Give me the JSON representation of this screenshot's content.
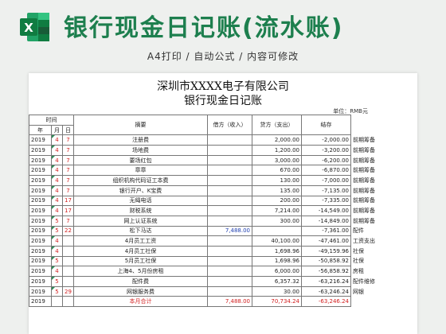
{
  "banner": {
    "title": "银行现金日记账(流水账)",
    "subtitle": "A4打印 / 自动公式 / 内容可修改",
    "logo_letter": "X"
  },
  "sheet": {
    "company": "深圳市XXXX电子有限公司",
    "title": "银行现金日记账",
    "unit": "单位：RMB元",
    "headers": {
      "time": "时间",
      "year": "年",
      "month": "月",
      "day": "日",
      "summary": "摘要",
      "debit": "借方（收入）",
      "credit": "贷方（支出）",
      "balance": "结存"
    },
    "rows": [
      {
        "year": "2019",
        "month": "4",
        "day": "7",
        "summary": "注册费",
        "debit": "",
        "credit": "2,000.00",
        "balance": "-2,000.00",
        "note": "前期筹备"
      },
      {
        "year": "2019",
        "month": "4",
        "day": "7",
        "summary": "场地费",
        "debit": "",
        "credit": "1,200.00",
        "balance": "-3,200.00",
        "note": "前期筹备"
      },
      {
        "year": "2019",
        "month": "4",
        "day": "7",
        "summary": "要场红包",
        "debit": "",
        "credit": "3,000.00",
        "balance": "-6,200.00",
        "note": "前期筹备"
      },
      {
        "year": "2019",
        "month": "4",
        "day": "7",
        "summary": "章章",
        "debit": "",
        "credit": "670.00",
        "balance": "-6,870.00",
        "note": "前期筹备"
      },
      {
        "year": "2019",
        "month": "4",
        "day": "7",
        "summary": "组织机构代码证工本费",
        "debit": "",
        "credit": "130.00",
        "balance": "-7,000.00",
        "note": "前期筹备"
      },
      {
        "year": "2019",
        "month": "4",
        "day": "7",
        "summary": "银行开户、K宝费",
        "debit": "",
        "credit": "135.00",
        "balance": "-7,135.00",
        "note": "前期筹备"
      },
      {
        "year": "2019",
        "month": "4",
        "day": "17",
        "summary": "无绳电话",
        "debit": "",
        "credit": "200.00",
        "balance": "-7,335.00",
        "note": "前期筹备"
      },
      {
        "year": "2019",
        "month": "4",
        "day": "17",
        "summary": "财税系统",
        "debit": "",
        "credit": "7,214.00",
        "balance": "-14,549.00",
        "note": "前期筹备"
      },
      {
        "year": "2019",
        "month": "5",
        "day": "7",
        "summary": "网上认证系统",
        "debit": "",
        "credit": "300.00",
        "balance": "-14,849.00",
        "note": "前期筹备"
      },
      {
        "year": "2019",
        "month": "5",
        "day": "22",
        "summary": "松下马达",
        "debit": "7,488.00",
        "credit": "",
        "balance": "-7,361.00",
        "note": "配件"
      },
      {
        "year": "2019",
        "month": "4",
        "day": "",
        "summary": "4月员工工资",
        "debit": "",
        "credit": "40,100.00",
        "balance": "-47,461.00",
        "note": "工资支出"
      },
      {
        "year": "2019",
        "month": "4",
        "day": "",
        "summary": "4月员工社保",
        "debit": "",
        "credit": "1,698.96",
        "balance": "-49,159.96",
        "note": "社保"
      },
      {
        "year": "2019",
        "month": "5",
        "day": "",
        "summary": "5月员工社保",
        "debit": "",
        "credit": "1,698.96",
        "balance": "-50,858.92",
        "note": "社保"
      },
      {
        "year": "2019",
        "month": "4",
        "day": "",
        "summary": "上海4、5月份房租",
        "debit": "",
        "credit": "6,000.00",
        "balance": "-56,858.92",
        "note": "房租"
      },
      {
        "year": "2019",
        "month": "5",
        "day": "",
        "summary": "配件费",
        "debit": "",
        "credit": "6,357.32",
        "balance": "-63,216.24",
        "note": "配件维修"
      },
      {
        "year": "2019",
        "month": "5",
        "day": "29",
        "summary": "网银服务费",
        "debit": "",
        "credit": "30.00",
        "balance": "-63,246.24",
        "note": "网银"
      }
    ],
    "total": {
      "year": "2019",
      "label": "本月合计",
      "debit": "7,488.00",
      "credit": "70,734.24",
      "balance": "-63,246.24"
    }
  }
}
